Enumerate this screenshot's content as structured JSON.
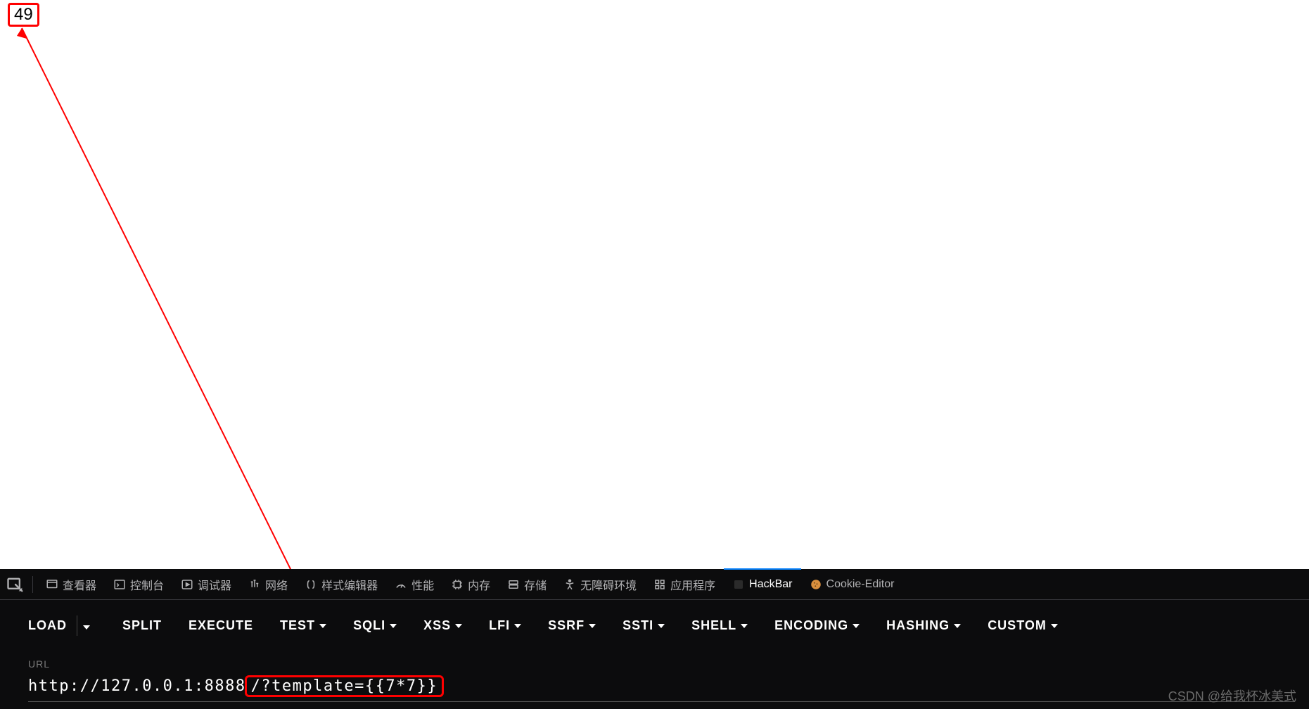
{
  "page": {
    "result": "49"
  },
  "devtools": {
    "tabs": {
      "inspector": "查看器",
      "console": "控制台",
      "debugger": "调试器",
      "network": "网络",
      "style_editor": "样式编辑器",
      "performance": "性能",
      "memory": "内存",
      "storage": "存储",
      "accessibility": "无障碍环境",
      "application": "应用程序",
      "hackbar": "HackBar",
      "cookie_editor": "Cookie-Editor"
    }
  },
  "hackbar": {
    "menu": {
      "load": "LOAD",
      "split": "SPLIT",
      "execute": "EXECUTE",
      "test": "TEST",
      "sqli": "SQLI",
      "xss": "XSS",
      "lfi": "LFI",
      "ssrf": "SSRF",
      "ssti": "SSTI",
      "shell": "SHELL",
      "encoding": "ENCODING",
      "hashing": "HASHING",
      "custom": "CUSTOM"
    },
    "url": {
      "label": "URL",
      "prefix": "http://127.0.0.1:8888",
      "query": "/?template={{7*7}}"
    }
  },
  "watermark": "CSDN @给我杯冰美式"
}
